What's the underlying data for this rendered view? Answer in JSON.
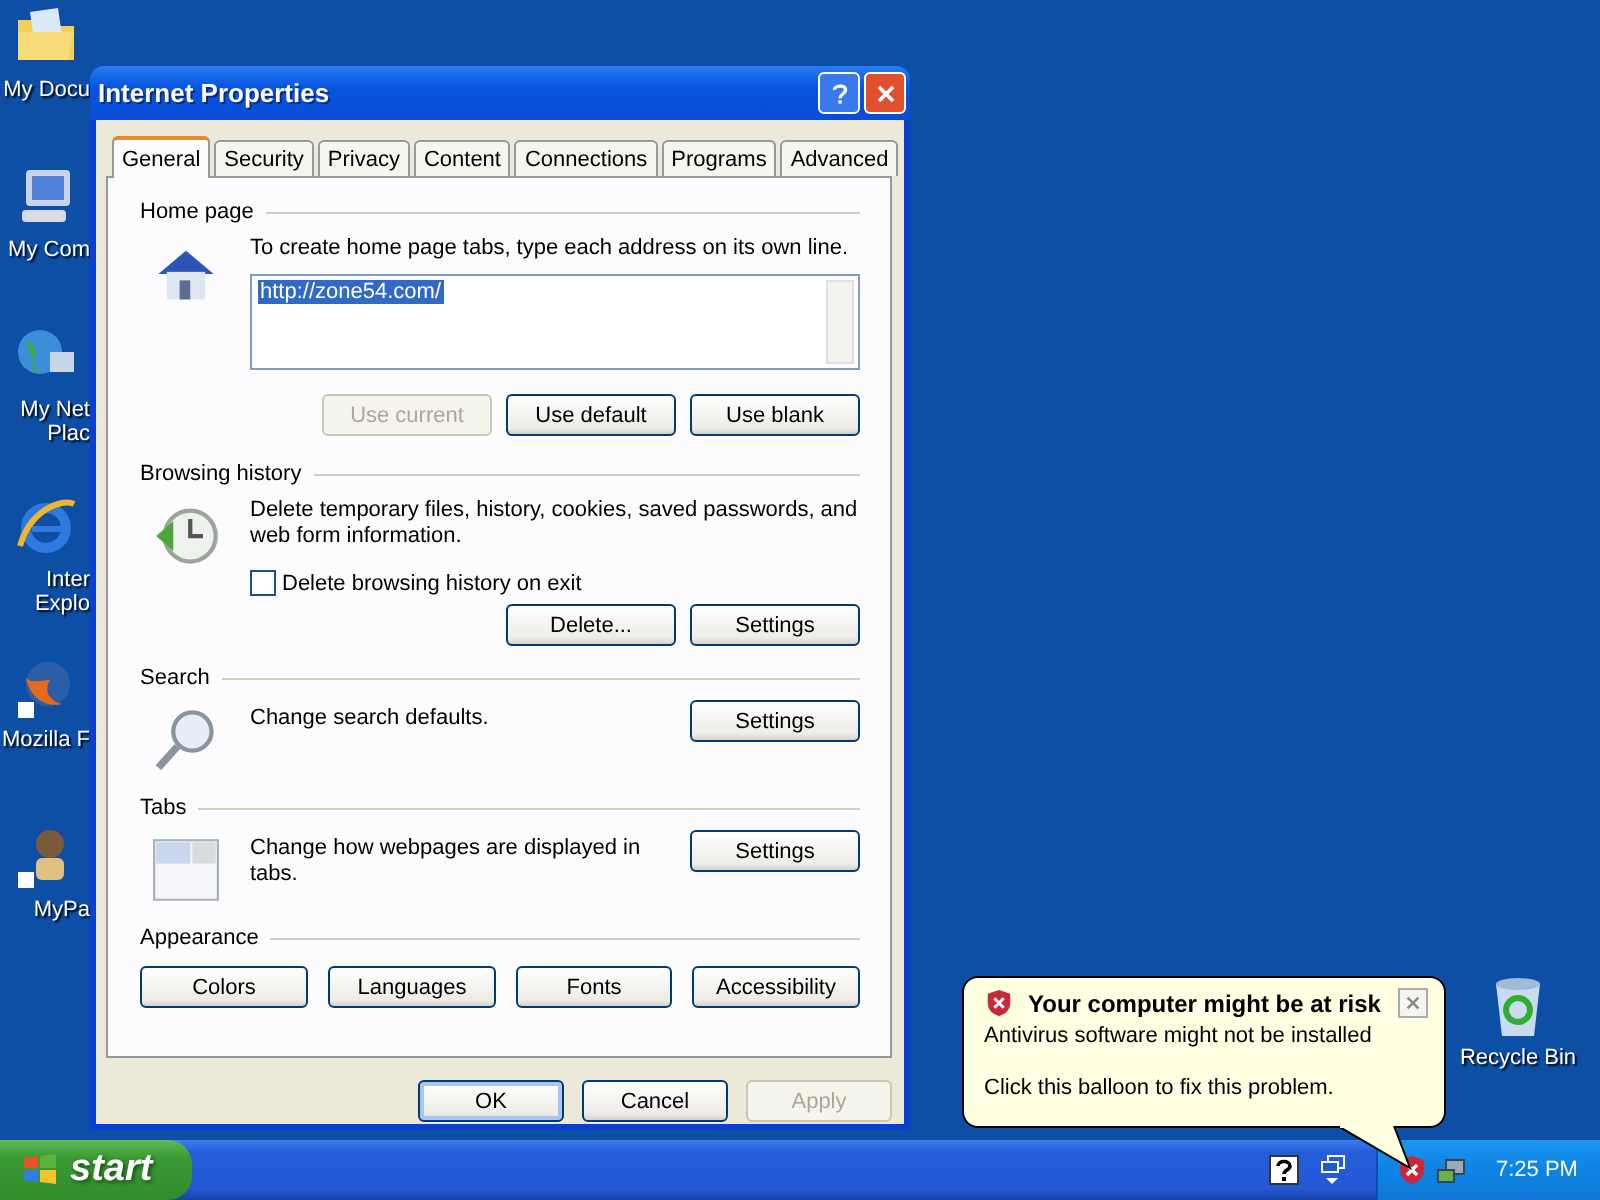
{
  "desktop_icons": [
    {
      "kind": "folder",
      "label": [
        "My Docu"
      ]
    },
    {
      "kind": "computer",
      "label": [
        "My Com"
      ]
    },
    {
      "kind": "network",
      "label": [
        "My Net",
        "Plac"
      ]
    },
    {
      "kind": "browser",
      "label": [
        "Inter",
        "Explo"
      ]
    },
    {
      "kind": "fox",
      "label": [
        "Mozilla F"
      ]
    },
    {
      "kind": "figure",
      "label": [
        "MyPa"
      ]
    }
  ],
  "dialog": {
    "title": "Internet Properties",
    "tabs": [
      {
        "label": "General",
        "selected": true
      },
      {
        "label": "Security",
        "selected": false
      },
      {
        "label": "Privacy",
        "selected": false
      },
      {
        "label": "Content",
        "selected": false
      },
      {
        "label": "Connections",
        "selected": false
      },
      {
        "label": "Programs",
        "selected": false
      },
      {
        "label": "Advanced",
        "selected": false
      }
    ],
    "home_page": {
      "heading": "Home page",
      "instruction": "To create home page tabs, type each address on its own line.",
      "url": "http://zone54.com/",
      "url_selected": true,
      "buttons": [
        {
          "label": "Use current",
          "disabled": true
        },
        {
          "label": "Use default",
          "disabled": false
        },
        {
          "label": "Use blank",
          "disabled": false
        }
      ]
    },
    "browsing_history": {
      "heading": "Browsing history",
      "description": "Delete temporary files, history, cookies, saved passwords, and web form information.",
      "checkbox": {
        "label": "Delete browsing history on exit",
        "checked": false
      },
      "buttons": [
        {
          "label": "Delete...",
          "disabled": false
        },
        {
          "label": "Settings",
          "disabled": false
        }
      ]
    },
    "search": {
      "heading": "Search",
      "description": "Change search defaults.",
      "buttons": [
        {
          "label": "Settings",
          "disabled": false
        }
      ]
    },
    "tabs_section": {
      "heading": "Tabs",
      "description": "Change how webpages are displayed in tabs.",
      "buttons": [
        {
          "label": "Settings",
          "disabled": false
        }
      ]
    },
    "appearance": {
      "heading": "Appearance",
      "buttons": [
        {
          "label": "Colors",
          "disabled": false
        },
        {
          "label": "Languages",
          "disabled": false
        },
        {
          "label": "Fonts",
          "disabled": false
        },
        {
          "label": "Accessibility",
          "disabled": false
        }
      ]
    },
    "footer_buttons": [
      {
        "label": "OK",
        "disabled": false,
        "default": true
      },
      {
        "label": "Cancel",
        "disabled": false,
        "default": false
      },
      {
        "label": "Apply",
        "disabled": true,
        "default": false
      }
    ]
  },
  "balloon": {
    "title": "Your computer might be at risk",
    "lines": [
      "Antivirus software might not be installed",
      "Click this balloon to fix this problem."
    ]
  },
  "recycle_bin": {
    "label": "Recycle Bin"
  },
  "taskbar": {
    "start": "start",
    "clock": "7:25 PM"
  }
}
